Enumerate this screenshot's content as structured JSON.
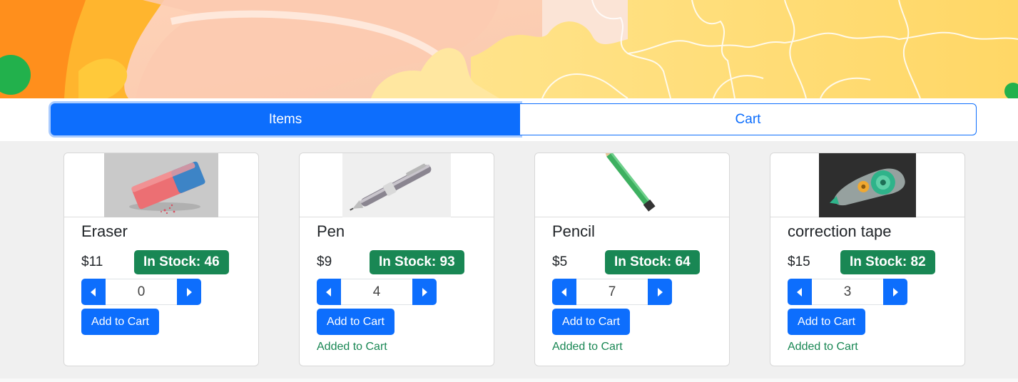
{
  "colors": {
    "primary": "#0d6efd",
    "success": "#198754",
    "area_background": "#f0f0f0"
  },
  "tabs": [
    {
      "label": "Items",
      "active": true
    },
    {
      "label": "Cart",
      "active": false
    }
  ],
  "products": [
    {
      "name": "Eraser",
      "price": "$11",
      "stock": "In Stock: 46",
      "quantity": "0",
      "add_label": "Add to Cart",
      "status": "",
      "image": "eraser-image"
    },
    {
      "name": "Pen",
      "price": "$9",
      "stock": "In Stock: 93",
      "quantity": "4",
      "add_label": "Add to Cart",
      "status": "Added to Cart",
      "image": "pen-image"
    },
    {
      "name": "Pencil",
      "price": "$5",
      "stock": "In Stock: 64",
      "quantity": "7",
      "add_label": "Add to Cart",
      "status": "Added to Cart",
      "image": "pencil-image"
    },
    {
      "name": "correction tape",
      "price": "$15",
      "stock": "In Stock: 82",
      "quantity": "3",
      "add_label": "Add to Cart",
      "status": "Added to Cart",
      "image": "correction-tape-image"
    }
  ]
}
